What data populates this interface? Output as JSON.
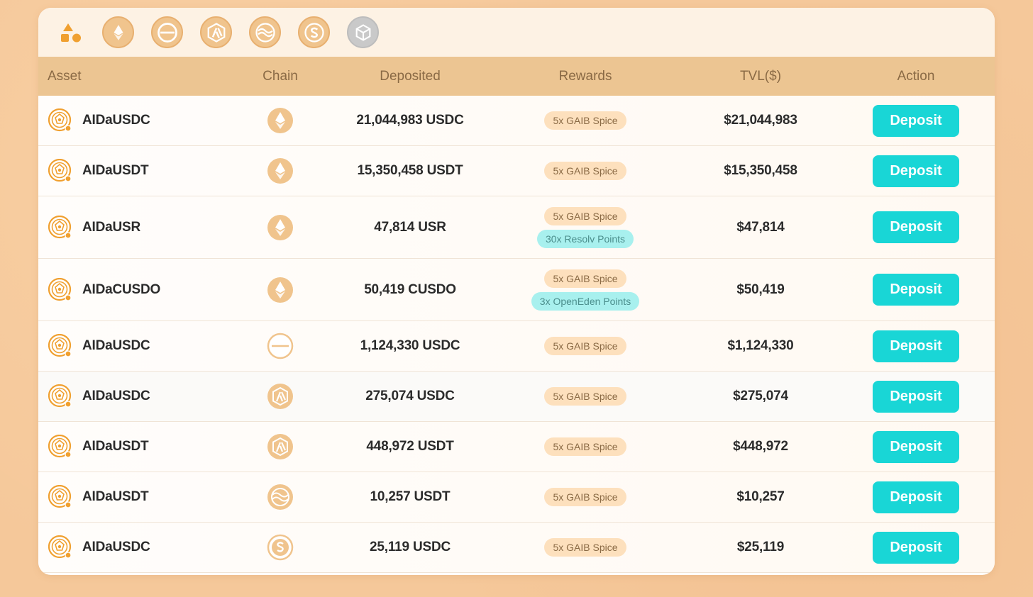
{
  "filters": [
    {
      "name": "all-filter",
      "icon": "shapes-icon"
    },
    {
      "name": "ethereum-filter",
      "icon": "ethereum-icon"
    },
    {
      "name": "base-filter",
      "icon": "minus-circle-icon"
    },
    {
      "name": "arbitrum-filter",
      "icon": "arbitrum-icon"
    },
    {
      "name": "sei-filter",
      "icon": "waves-icon"
    },
    {
      "name": "sonic-filter",
      "icon": "s-icon"
    },
    {
      "name": "bnb-filter",
      "icon": "cube-icon"
    }
  ],
  "columns": {
    "asset": "Asset",
    "chain": "Chain",
    "deposited": "Deposited",
    "rewards": "Rewards",
    "tvl": "TVL($)",
    "action": "Action"
  },
  "colors": {
    "accent": "#19d6d6",
    "header_bg": "#ecc592",
    "badge_spice": "#fde0bd",
    "badge_points": "#a8f0ee",
    "icon_orange": "#f0a030"
  },
  "rows": [
    {
      "asset": "AIDaUSDC",
      "chain_icon": "ethereum-icon",
      "deposited": "21,044,983 USDC",
      "rewards": [
        "5x GAIB Spice"
      ],
      "tvl": "$21,044,983",
      "action": "Deposit"
    },
    {
      "asset": "AIDaUSDT",
      "chain_icon": "ethereum-icon",
      "deposited": "15,350,458 USDT",
      "rewards": [
        "5x GAIB Spice"
      ],
      "tvl": "$15,350,458",
      "action": "Deposit"
    },
    {
      "asset": "AIDaUSR",
      "chain_icon": "ethereum-icon",
      "deposited": "47,814 USR",
      "rewards": [
        "5x GAIB Spice",
        "30x Resolv Points"
      ],
      "tvl": "$47,814",
      "action": "Deposit"
    },
    {
      "asset": "AIDaCUSDO",
      "chain_icon": "ethereum-icon",
      "deposited": "50,419 CUSDO",
      "rewards": [
        "5x GAIB Spice",
        "3x OpenEden Points"
      ],
      "tvl": "$50,419",
      "action": "Deposit"
    },
    {
      "asset": "AIDaUSDC",
      "chain_icon": "base-icon",
      "deposited": "1,124,330 USDC",
      "rewards": [
        "5x GAIB Spice"
      ],
      "tvl": "$1,124,330",
      "action": "Deposit"
    },
    {
      "asset": "AIDaUSDC",
      "chain_icon": "arbitrum-icon",
      "deposited": "275,074 USDC",
      "rewards": [
        "5x GAIB Spice"
      ],
      "tvl": "$275,074",
      "action": "Deposit"
    },
    {
      "asset": "AIDaUSDT",
      "chain_icon": "arbitrum-icon",
      "deposited": "448,972 USDT",
      "rewards": [
        "5x GAIB Spice"
      ],
      "tvl": "$448,972",
      "action": "Deposit"
    },
    {
      "asset": "AIDaUSDT",
      "chain_icon": "sei-icon",
      "deposited": "10,257 USDT",
      "rewards": [
        "5x GAIB Spice"
      ],
      "tvl": "$10,257",
      "action": "Deposit"
    },
    {
      "asset": "AIDaUSDC",
      "chain_icon": "sonic-icon",
      "deposited": "25,119 USDC",
      "rewards": [
        "5x GAIB Spice"
      ],
      "tvl": "$25,119",
      "action": "Deposit"
    }
  ]
}
